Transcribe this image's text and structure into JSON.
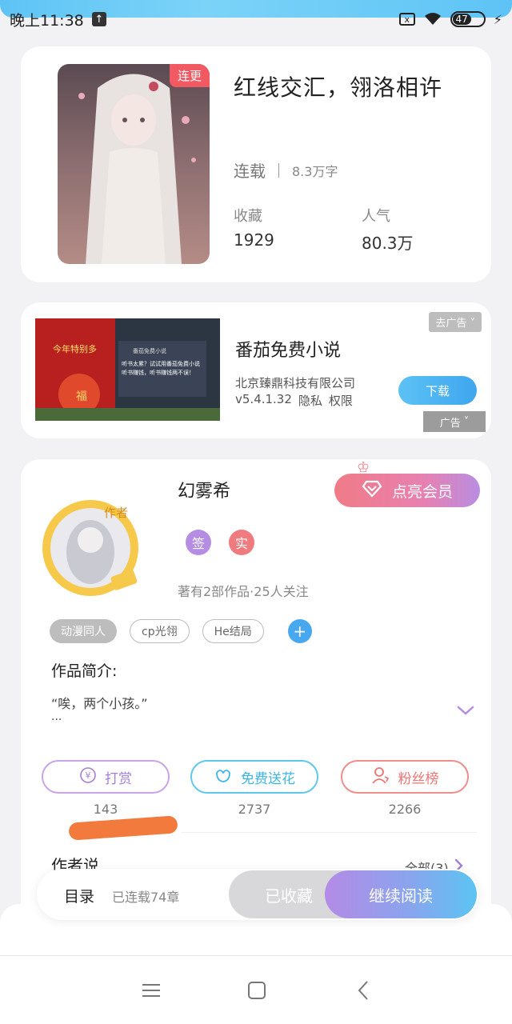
{
  "status_bar": {
    "time": "晚上11:38",
    "sim_label": "x",
    "battery": "47"
  },
  "book": {
    "cover_badge": "连更",
    "title": "红线交汇，翎洛相许",
    "status": "连载",
    "word_count": "8.3万字",
    "favorites_label": "收藏",
    "favorites_value": "1929",
    "popularity_label": "人气",
    "popularity_value": "80.3万"
  },
  "ad": {
    "close_label": "去广告 ˅",
    "title": "番茄免费小说",
    "company": "北京臻鼎科技有限公司",
    "version": "v5.4.1.32",
    "privacy": "隐私",
    "permission": "权限",
    "download_label": "下载",
    "ad_label": "广告",
    "thumb_text_1": "今年特别多",
    "thumb_text_2": "听书太累？试试用番茄免费小说听书赚钱，听书赚钱两不误！",
    "thumb_app": "番茄免费小说"
  },
  "author": {
    "name": "幻雾希",
    "vip_label": "点亮会员",
    "avatar_tag": "作者",
    "badge_sign": "签",
    "badge_real": "实",
    "info": "著有2部作品·25人关注",
    "tags": [
      "动漫同人",
      "cp光翎",
      "He结局"
    ],
    "intro_label": "作品简介:",
    "intro_text": "“唉，两个小孩。”",
    "intro_ellipsis": "...",
    "actions": [
      {
        "label": "打赏",
        "count": "143"
      },
      {
        "label": "免费送花",
        "count": "2737"
      },
      {
        "label": "粉丝榜",
        "count": "2266"
      }
    ],
    "author_says": "作者说",
    "all_link": "全部(3)"
  },
  "bottom_bar": {
    "toc_label": "目录",
    "toc_count": "已连载74章",
    "saved_label": "已收藏",
    "read_label": "继续阅读"
  },
  "colors": {
    "accent_blue": "#47a8f0",
    "badge_red": "#f25a63",
    "vip_pink": "#f07b87",
    "purple": "#b58ee4"
  }
}
